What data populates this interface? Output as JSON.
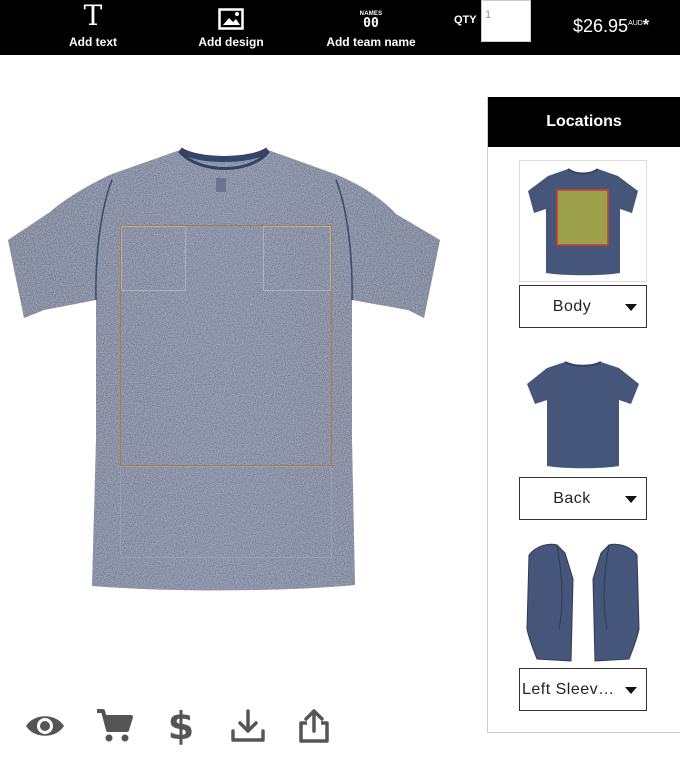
{
  "toolbar": {
    "add_text": "Add text",
    "add_design": "Add design",
    "add_team_name": "Add team name",
    "team_icon_top": "NAMES",
    "team_icon_bottom": "00",
    "text_icon_glyph": "T",
    "qty_label": "QTY",
    "qty_value": "1",
    "price": "$26.95",
    "currency": "AUD",
    "price_mark": "*"
  },
  "product": {
    "color_name": "stone wash navy",
    "shirt_color": "#46557a",
    "print_area_color": "#b07a3e",
    "thumb_highlight_color": "#9da04a"
  },
  "locations": {
    "title": "Locations",
    "items": [
      {
        "id": "body",
        "label": "Body",
        "icon": "tshirt-front-thumbnail"
      },
      {
        "id": "back",
        "label": "Back",
        "icon": "tshirt-back-thumbnail"
      },
      {
        "id": "left-sleeve",
        "label": "Left Sleeve (Short)",
        "icon": "sleeve-thumbnail"
      }
    ]
  },
  "actions": [
    {
      "id": "preview",
      "icon": "eye-icon"
    },
    {
      "id": "cart",
      "icon": "cart-icon"
    },
    {
      "id": "pricing",
      "icon": "dollar-icon",
      "glyph": "$"
    },
    {
      "id": "download",
      "icon": "download-icon"
    },
    {
      "id": "share",
      "icon": "share-icon"
    }
  ]
}
